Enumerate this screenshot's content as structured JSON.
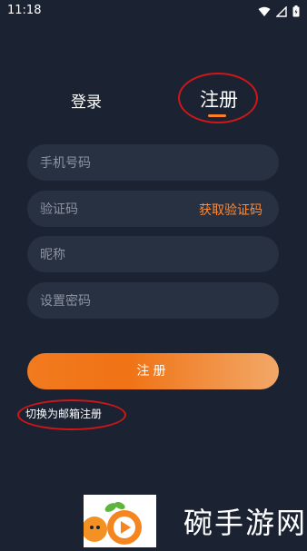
{
  "status_bar": {
    "time": "11:18",
    "icons": [
      "wifi-icon",
      "signal-icon",
      "battery-icon"
    ]
  },
  "tabs": {
    "login_label": "登录",
    "register_label": "注册",
    "active": "register"
  },
  "form": {
    "phone": {
      "placeholder": "手机号码",
      "value": ""
    },
    "code": {
      "placeholder": "验证码",
      "value": "",
      "get_code_label": "获取验证码"
    },
    "nickname": {
      "placeholder": "昵称",
      "value": ""
    },
    "password": {
      "placeholder": "设置密码",
      "value": ""
    },
    "submit_label": "注册",
    "switch_email_label": "切换为邮箱注册"
  },
  "watermark": {
    "text": "碗手游网"
  },
  "colors": {
    "background": "#1b2333",
    "field": "#283142",
    "accent": "#ff8a32",
    "annotation": "#d01616"
  }
}
